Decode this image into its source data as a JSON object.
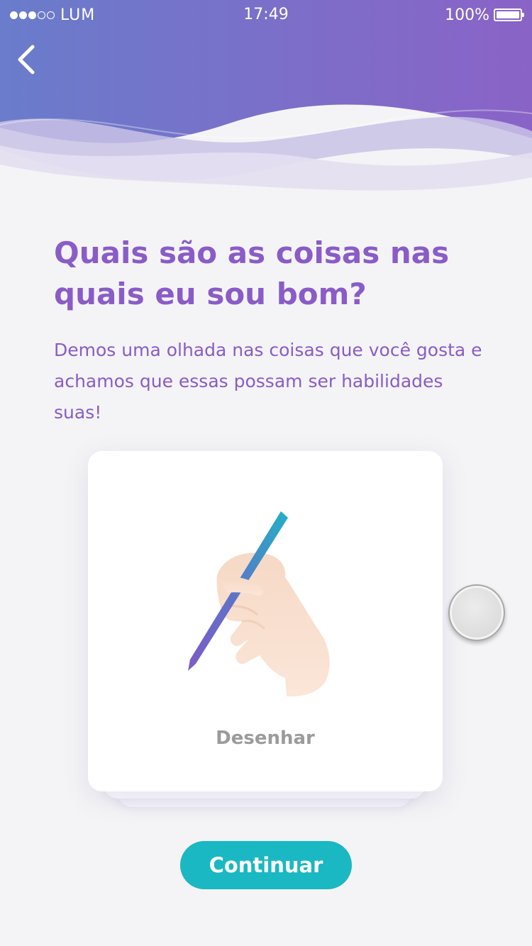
{
  "status_bar": {
    "carrier": "LUM",
    "time": "17:49",
    "battery": "100%",
    "signal_bars_filled": 3,
    "signal_bars_total": 5
  },
  "nav": {
    "back_icon": "chevron-left-icon"
  },
  "main": {
    "title": "Quais são as coisas nas quais eu sou bom?",
    "description": "Demos uma olhada nas coisas que você gosta e achamos que essas possam ser habilidades suas!"
  },
  "card": {
    "label": "Desenhar",
    "illustration_icon": "hand-drawing-pencil-icon"
  },
  "actions": {
    "continue_label": "Continuar"
  },
  "colors": {
    "header_gradient_start": "#6a7ccb",
    "header_gradient_end": "#8a63c7",
    "title": "#8a5cc7",
    "button": "#1ab8c2",
    "card_label": "#9b9b9b",
    "background": "#f4f4f6"
  }
}
